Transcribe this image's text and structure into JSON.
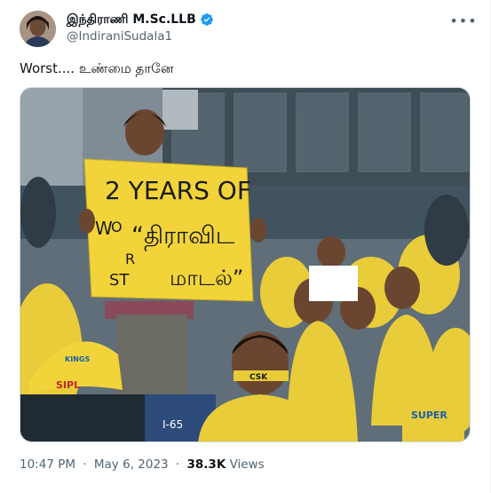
{
  "header": {
    "display_name": "இந்திராணி M.Sc.LLB",
    "handle": "@IndiraniSudala1",
    "more_icon": "more-horizontal-icon",
    "verified_icon": "verified-badge-icon",
    "verified_color": "#1d9bf0"
  },
  "tweet": {
    "text": "Worst.... உண்மை தானே"
  },
  "media": {
    "sign": {
      "line1": "2 YEARS OF",
      "side_w": "W",
      "side_o": "O",
      "side_r": "R",
      "side_st": "ST",
      "quote": "“திராவிட",
      "line3": "மாடல்”"
    },
    "cap_text": "SIPL",
    "cap_brand": "KINGS",
    "seat_number": "I-65",
    "headband_text": "CSK",
    "shirt_text": "SUPER"
  },
  "meta": {
    "time": "10:47 PM",
    "dot": "·",
    "date": "May 6, 2023",
    "views_count": "38.3K",
    "views_label": "Views"
  }
}
